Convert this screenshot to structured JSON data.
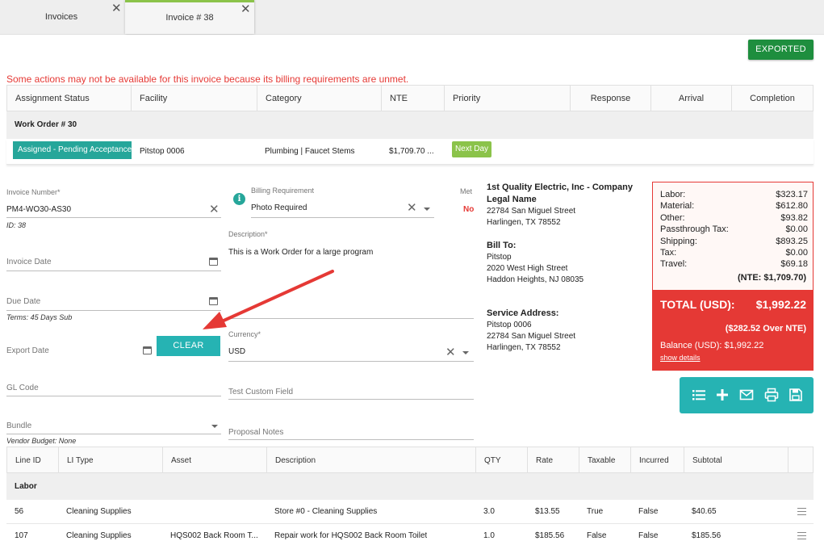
{
  "tabs": [
    {
      "label": "Invoices"
    },
    {
      "label": "Invoice # 38"
    }
  ],
  "status_button": "EXPORTED",
  "warning": "Some actions may not be available for this invoice because its billing requirements are unmet.",
  "work_order_table": {
    "headers": [
      "Assignment Status",
      "Facility",
      "Category",
      "NTE",
      "Priority",
      "Response",
      "Arrival",
      "Completion"
    ],
    "group": "Work Order # 30",
    "row": {
      "status": "Assigned - Pending Acceptance",
      "facility": "Pitstop 0006",
      "category": "Plumbing | Faucet Stems",
      "nte": "$1,709.70 ...",
      "priority": "Next Day"
    }
  },
  "form": {
    "invoice_number": {
      "label": "Invoice Number*",
      "value": "PM4-WO30-AS30",
      "note": "ID: 38"
    },
    "invoice_date": {
      "label": "Invoice Date"
    },
    "due_date": {
      "label": "Due Date",
      "note": "Terms: 45 Days Sub"
    },
    "export_date": {
      "label": "Export Date",
      "clear_label": "CLEAR"
    },
    "gl_code": {
      "label": "GL Code"
    },
    "bundle": {
      "label": "Bundle",
      "note": "Vendor Budget: None"
    },
    "billing_requirement": {
      "label": "Billing Requirement",
      "value": "Photo Required",
      "met_label": "Met",
      "met_value": "No"
    },
    "description": {
      "label": "Description*",
      "value": "This is a Work Order for a large program"
    },
    "currency": {
      "label": "Currency*",
      "value": "USD"
    },
    "test_custom_field": {
      "label": "Test Custom Field"
    },
    "proposal_notes": {
      "label": "Proposal Notes"
    }
  },
  "vendor": {
    "name_line1": "1st Quality Electric, Inc - Company",
    "name_line2": "Legal Name",
    "street": "22784 San Miguel Street",
    "city": "Harlingen, TX 78552"
  },
  "bill_to": {
    "title": "Bill To:",
    "name": "Pitstop",
    "street": "2020 West High Street",
    "city": "Haddon Heights, NJ 08035"
  },
  "service_address": {
    "title": "Service Address:",
    "name": "Pitstop 0006",
    "street": "22784 San Miguel Street",
    "city": "Harlingen, TX 78552"
  },
  "summary": {
    "lines": [
      {
        "k": "Labor:",
        "v": "$323.17"
      },
      {
        "k": "Material:",
        "v": "$612.80"
      },
      {
        "k": "Other:",
        "v": "$93.82"
      },
      {
        "k": "Passthrough Tax:",
        "v": "$0.00"
      },
      {
        "k": "Shipping:",
        "v": "$893.25"
      },
      {
        "k": "Tax:",
        "v": "$0.00"
      },
      {
        "k": "Travel:",
        "v": "$69.18"
      }
    ],
    "nte": "(NTE: $1,709.70)",
    "total_label": "TOTAL (USD):",
    "total_value": "$1,992.22",
    "over_nte": "($282.52 Over NTE)",
    "balance": "Balance (USD): $1,992.22",
    "show_details": "show details"
  },
  "actions": [
    "list-icon",
    "plus-icon",
    "mail-icon",
    "print-icon",
    "save-icon"
  ],
  "line_items": {
    "headers": [
      "Line ID",
      "LI Type",
      "Asset",
      "Description",
      "QTY",
      "Rate",
      "Taxable",
      "Incurred",
      "Subtotal"
    ],
    "group": "Labor",
    "rows": [
      {
        "id": "56",
        "type": "Cleaning Supplies",
        "asset": "",
        "description": "Store #0 - Cleaning Supplies",
        "qty": "3.0",
        "rate": "$13.55",
        "taxable": "True",
        "incurred": "False",
        "subtotal": "$40.65"
      },
      {
        "id": "107",
        "type": "Cleaning Supplies",
        "asset": "HQS002 Back Room T...",
        "description": "Repair work for HQS002 Back Room Toilet",
        "qty": "1.0",
        "rate": "$185.56",
        "taxable": "False",
        "incurred": "False",
        "subtotal": "$185.56"
      }
    ]
  },
  "colors": {
    "accent": "#26b3b3",
    "danger": "#e53935",
    "success": "#1e8e3e",
    "priority": "#8bc34a"
  }
}
